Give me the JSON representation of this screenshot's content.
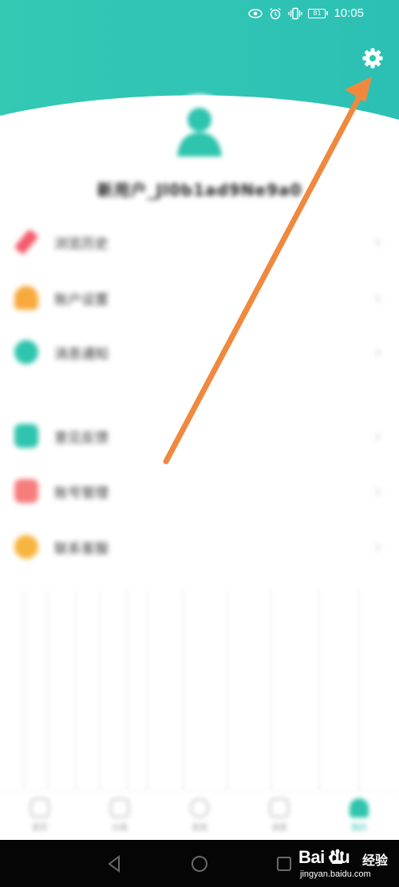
{
  "status_bar": {
    "carrier": "",
    "time": "10:05",
    "battery": "81"
  },
  "profile": {
    "username": "新用户_Jl0b1ad9Ne9a0"
  },
  "menu": {
    "group1": [
      {
        "label": "浏览历史",
        "icon": "history-icon",
        "color": "#f45a6a"
      },
      {
        "label": "账户设置",
        "icon": "account-icon",
        "color": "#f7a93b"
      },
      {
        "label": "消息通知",
        "icon": "message-icon",
        "color": "#2ec4ad"
      }
    ],
    "group2": [
      {
        "label": "意见反馈",
        "icon": "feedback-icon",
        "color": "#2ec4ad"
      },
      {
        "label": "账号管理",
        "icon": "manage-icon",
        "color": "#f77c7c"
      },
      {
        "label": "联系客服",
        "icon": "service-icon",
        "color": "#f7b440"
      }
    ]
  },
  "bottom_nav": [
    {
      "label": "首页",
      "active": false
    },
    {
      "label": "分类",
      "active": false
    },
    {
      "label": "发现",
      "active": false
    },
    {
      "label": "消息",
      "active": false
    },
    {
      "label": "我的",
      "active": true
    }
  ],
  "watermark": {
    "brand": "Bai du",
    "cn": "经验",
    "sub": "jingyan.baidu.com"
  },
  "colors": {
    "header_teal": "#2ec4ad",
    "arrow": "#f0883e",
    "accent": "#2ec4ad"
  }
}
